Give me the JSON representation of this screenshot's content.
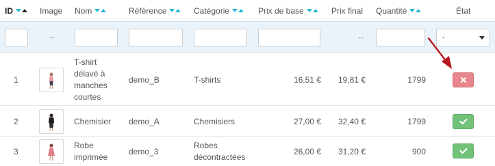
{
  "headers": {
    "id": "ID",
    "image": "Image",
    "nom": "Nom",
    "reference": "Référence",
    "categorie": "Catégorie",
    "prix_base": "Prix de base",
    "prix_final": "Prix final",
    "quantite": "Quantité",
    "etat": "État"
  },
  "filters": {
    "image_placeholder": "--",
    "prix_final_placeholder": "--",
    "etat_selected": "-"
  },
  "rows": [
    {
      "id": "1",
      "nom_lines": [
        "T-shirt",
        "délavé à",
        "manches",
        "courtes"
      ],
      "reference": "demo_B",
      "categorie_lines": [
        "T-shirts"
      ],
      "prix_base": "16,51 €",
      "prix_final": "19,81 €",
      "quantite": "1799",
      "active": false,
      "image_icon": "tshirt-model-thumbnail-icon"
    },
    {
      "id": "2",
      "nom_lines": [
        "Chemisier"
      ],
      "reference": "demo_A",
      "categorie_lines": [
        "Chemisiers"
      ],
      "prix_base": "27,00 €",
      "prix_final": "32,40 €",
      "quantite": "1799",
      "active": true,
      "image_icon": "blouse-model-thumbnail-icon"
    },
    {
      "id": "3",
      "nom_lines": [
        "Robe",
        "imprimée"
      ],
      "reference": "demo_3",
      "categorie_lines": [
        "Robes",
        "décontractées"
      ],
      "prix_base": "26,00 €",
      "prix_final": "31,20 €",
      "quantite": "900",
      "active": true,
      "image_icon": "dress-model-thumbnail-icon"
    }
  ],
  "colors": {
    "sort_arrow": "#25b9d7",
    "filter_row_bg": "#eaf3fa",
    "status_off": "#e7878b",
    "status_on": "#72c279",
    "annotation_arrow": "#b8161c"
  }
}
